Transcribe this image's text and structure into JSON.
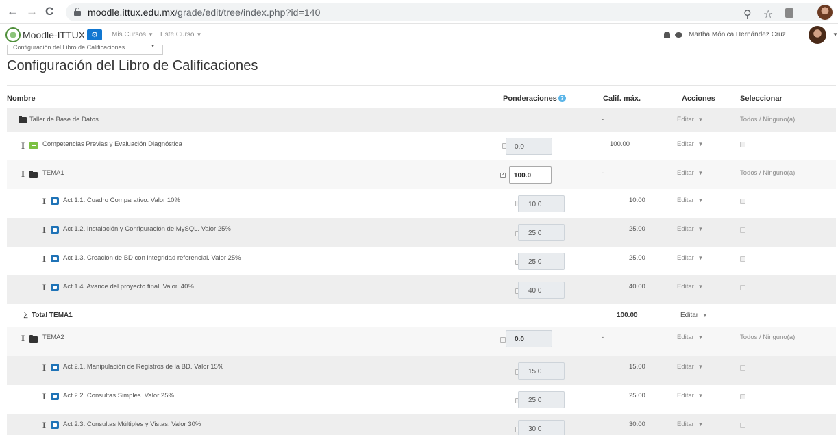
{
  "browser": {
    "back": "←",
    "forward": "→",
    "reload": "C",
    "url_host": "moodle.ittux.edu.mx",
    "url_path": "/grade/edit/tree/index.php?id=140",
    "zoom": "⚲",
    "star": "☆"
  },
  "navbar": {
    "site_name": "Moodle-ITTUX",
    "gear": "⚙",
    "mis_cursos": "Mis Cursos",
    "este_curso": "Este Curso",
    "caret": "▼",
    "user_name": "Martha Mónica Hernández Cruz"
  },
  "selector": {
    "label": "Configuración del Libro de Calificaciones",
    "caret": "▼"
  },
  "page": {
    "title": "Configuración del Libro de Calificaciones"
  },
  "table": {
    "headers": {
      "nombre": "Nombre",
      "ponderaciones": "Ponderaciones",
      "calif_max": "Calif. máx.",
      "acciones": "Acciones",
      "seleccionar": "Seleccionar"
    },
    "help": "?",
    "drag_glyph": "I",
    "sigma": "∑",
    "editar": "Editar",
    "caret": "▼",
    "todos": "Todos / Ninguno(a)",
    "category_root": {
      "name": "Taller de Base de Datos",
      "max": "-"
    },
    "competencias": {
      "name": "Competencias Previas y Evaluación Diagnóstica",
      "weight": "0.0",
      "max": "100.00"
    },
    "tema1": {
      "name": "TEMA1",
      "weight": "100.0",
      "max": "-"
    },
    "tema1_items": [
      {
        "name": "Act 1.1. Cuadro Comparativo. Valor 10%",
        "weight": "10.0",
        "max": "10.00"
      },
      {
        "name": "Act 1.2. Instalación y Configuración de MySQL. Valor 25%",
        "weight": "25.0",
        "max": "25.00"
      },
      {
        "name": "Act 1.3. Creación de BD con integridad referencial. Valor 25%",
        "weight": "25.0",
        "max": "25.00"
      },
      {
        "name": "Act 1.4. Avance del proyecto final. Valor. 40%",
        "weight": "40.0",
        "max": "40.00"
      }
    ],
    "total_tema1": {
      "name": "Total TEMA1",
      "max": "100.00"
    },
    "tema2": {
      "name": "TEMA2",
      "weight": "0.0",
      "max": "-"
    },
    "tema2_items": [
      {
        "name": "Act 2.1. Manipulación de Registros de la BD. Valor 15%",
        "weight": "15.0",
        "max": "15.00"
      },
      {
        "name": "Act 2.2. Consultas Simples. Valor 25%",
        "weight": "25.0",
        "max": "25.00"
      },
      {
        "name": "Act 2.3. Consultas Múltiples y Vistas. Valor 30%",
        "weight": "30.0",
        "max": "30.00"
      }
    ]
  }
}
